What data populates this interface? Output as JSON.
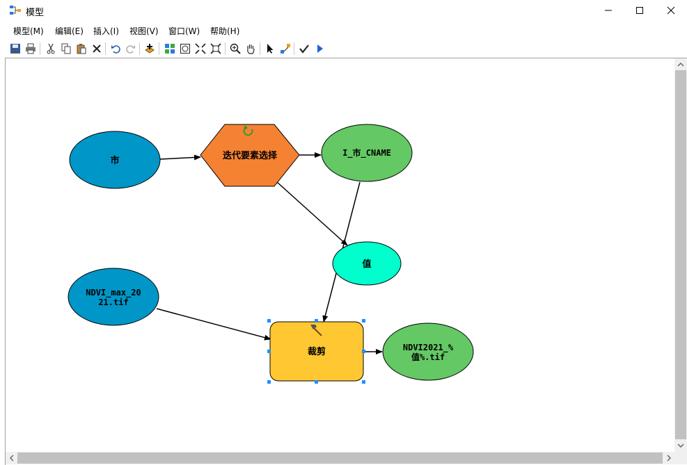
{
  "window": {
    "title": "模型",
    "controls": [
      "minimize",
      "maximize",
      "close"
    ]
  },
  "menu": [
    {
      "label": "模型(M)"
    },
    {
      "label": "编辑(E)"
    },
    {
      "label": "插入(I)"
    },
    {
      "label": "视图(V)"
    },
    {
      "label": "窗口(W)"
    },
    {
      "label": "帮助(H)"
    }
  ],
  "toolbar": [
    "save-icon",
    "print-icon",
    "cut-icon",
    "copy-icon",
    "paste-icon",
    "delete-icon",
    "undo-icon",
    "redo-icon",
    "add-data-icon",
    "auto-layout-icon",
    "full-extent-icon",
    "fixed-zoom-in-icon",
    "fixed-zoom-out-icon",
    "zoom-in-icon",
    "pan-icon",
    "select-icon",
    "connect-icon",
    "validate-icon",
    "run-icon"
  ],
  "model": {
    "nodes": {
      "shi": {
        "label": "市",
        "shape": "ellipse",
        "color": "#0096c8"
      },
      "iterate": {
        "label": "迭代要素选择",
        "shape": "hexagon",
        "color": "#f58232"
      },
      "cname": {
        "label": "I_市_CNAME",
        "shape": "ellipse",
        "color": "#64c864"
      },
      "value": {
        "label": "值",
        "shape": "ellipse",
        "color": "#00ffcc"
      },
      "ndvi_in": {
        "label_line1": "NDVI_max_20",
        "label_line2": "21.tif",
        "shape": "ellipse",
        "color": "#0096c8"
      },
      "clip": {
        "label": "裁剪",
        "shape": "rounded-rect",
        "color": "#ffc832",
        "selected": true
      },
      "output": {
        "label_line1": "NDVI2021_%",
        "label_line2": "值%.tif",
        "shape": "ellipse",
        "color": "#64c864"
      }
    },
    "connections": [
      [
        "shi",
        "iterate"
      ],
      [
        "iterate",
        "cname"
      ],
      [
        "iterate",
        "value"
      ],
      [
        "cname",
        "clip"
      ],
      [
        "ndvi_in",
        "clip"
      ],
      [
        "clip",
        "output"
      ]
    ]
  }
}
